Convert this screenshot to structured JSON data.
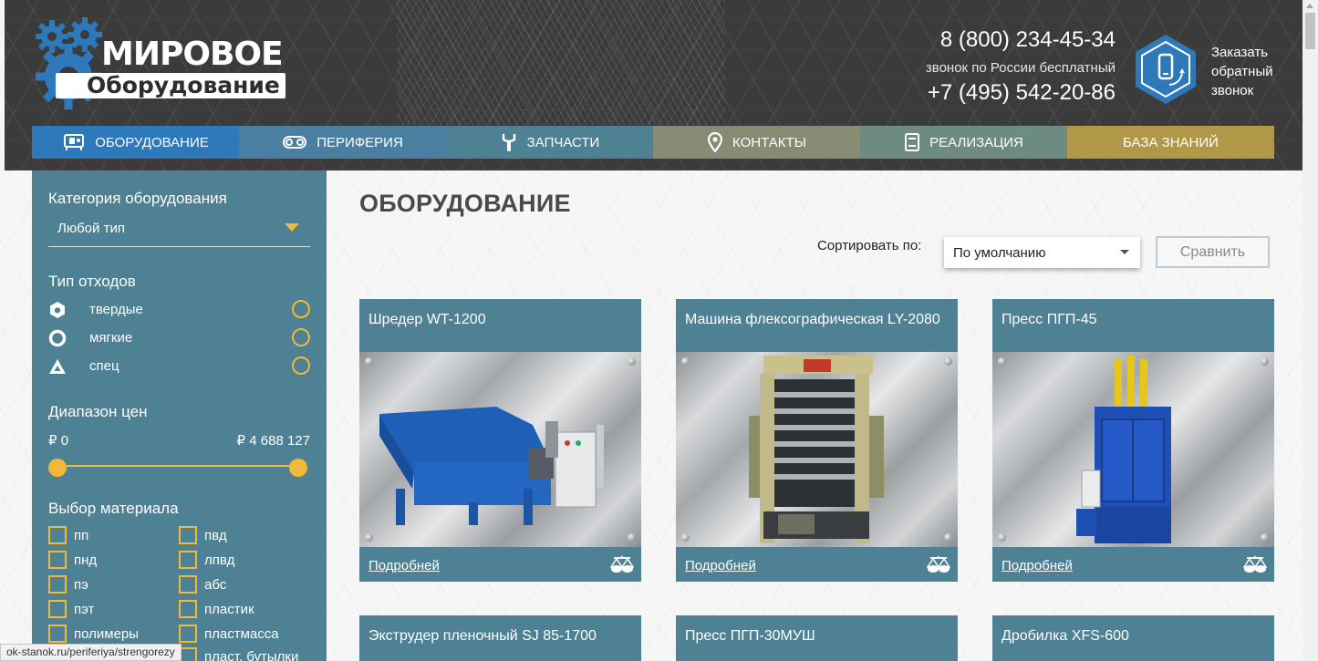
{
  "header": {
    "logo": {
      "line1": "МИРОВОЕ",
      "line2": "Оборудование"
    },
    "phone_primary": "8 (800) 234-45-34",
    "phone_note": "звонок по России бесплатный",
    "phone_secondary": "+7 (495) 542-20-86",
    "callback_label": "Заказать обратный звонок"
  },
  "nav": [
    {
      "label": "ОБОРУДОВАНИЕ",
      "icon": "machine-icon"
    },
    {
      "label": "ПЕРИФЕРИЯ",
      "icon": "conveyor-icon"
    },
    {
      "label": "ЗАПЧАСТИ",
      "icon": "wrench-icon"
    },
    {
      "label": "КОНТАКТЫ",
      "icon": "map-pin-icon"
    },
    {
      "label": "РЕАЛИЗАЦИЯ",
      "icon": "book-icon"
    },
    {
      "label": "БАЗА ЗНАНИЙ",
      "icon": ""
    }
  ],
  "sidebar": {
    "category_title": "Категория оборудования",
    "category_select": "Любой тип",
    "waste_title": "Тип отходов",
    "waste_types": [
      {
        "label": "твердые",
        "icon": "hexagon-icon"
      },
      {
        "label": "мягкие",
        "icon": "circle-icon"
      },
      {
        "label": "спец",
        "icon": "triangle-icon"
      }
    ],
    "price_title": "Диапазон цен",
    "price_min": "₽ 0",
    "price_max": "₽ 4 688 127",
    "price_range_fraction": [
      0,
      1
    ],
    "material_title": "Выбор материала",
    "materials_col1": [
      "пп",
      "пнд",
      "пэ",
      "пэт",
      "полимеры",
      ""
    ],
    "materials_col2": [
      "пвд",
      "лпвд",
      "абс",
      "пластик",
      "пластмасса",
      "пласт. бутылки"
    ]
  },
  "main": {
    "title": "ОБОРУДОВАНИЕ",
    "sort_label": "Сортировать по:",
    "sort_value": "По умолчанию",
    "compare_button": "Сравнить",
    "more_link": "Подробней",
    "products": [
      {
        "title": "Шредер WT-1200"
      },
      {
        "title": "Машина флексографическая LY-2080"
      },
      {
        "title": "Пресс ПГП-45"
      },
      {
        "title": "Экструдер пленочный SJ 85-1700"
      },
      {
        "title": "Пресс ПГП-30МУШ"
      },
      {
        "title": "Дробилка XFS-600"
      }
    ]
  },
  "statusbar": {
    "url": "ok-stanok.ru/periferiya/strengorezy"
  },
  "colors": {
    "sidebar": "#4e8193",
    "accent": "#f1b83a",
    "nav_active": "#2e79b9",
    "nav_knowledge": "#b19849"
  }
}
